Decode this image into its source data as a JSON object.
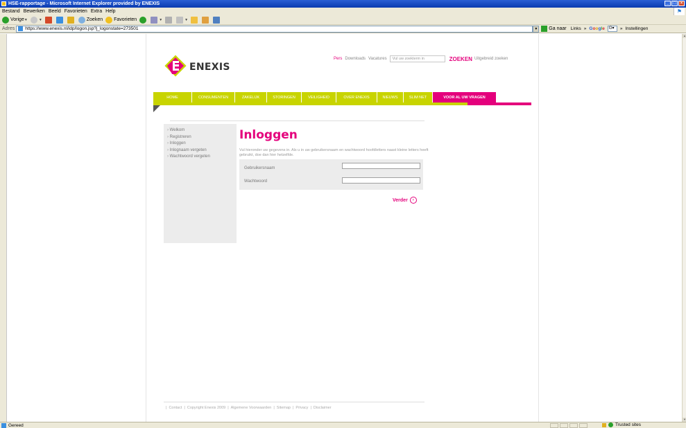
{
  "window": {
    "title": "HSE-rapportage - Microsoft Internet Explorer provided by ENEXIS"
  },
  "menu": [
    "Bestand",
    "Bewerken",
    "Beeld",
    "Favorieten",
    "Extra",
    "Help"
  ],
  "toolbar": {
    "back": "Vorige",
    "search": "Zoeken",
    "favorites": "Favorieten"
  },
  "address": {
    "label": "Adres",
    "url": "https://www.enexis.nl/idp/logon.jsp?j_logonstate=273501",
    "go": "Ga naar",
    "links": "Links",
    "settings": "Instellingen"
  },
  "site": {
    "brand": "ENEXIS",
    "toplinks": [
      "Pers",
      "Downloads",
      "Vacatures"
    ],
    "search_placeholder": "Vul uw zoekterm in",
    "search_button": "ZOEKEN",
    "advanced_search": "Uitgebreid zoeken",
    "nav": [
      "HOME",
      "CONSUMENTEN",
      "ZAKELIJK",
      "STORINGEN",
      "VEILIGHEID",
      "OVER ENEXIS",
      "NIEUWS",
      "SLIM NET",
      "VOOR AL UW VRAGEN"
    ],
    "sidebar": [
      "Welkom",
      "Registreren",
      "Inloggen",
      "Inlognaam vergeten",
      "Wachtwoord vergeten"
    ],
    "heading": "Inloggen",
    "intro": "Vul hieronder uw gegevens in. Als u in uw gebruikersnaam en wachtwoord hoofdletters naast kleine letters heeft gebruikt, doe dan hier hetzelfde.",
    "form": {
      "username_label": "Gebruikersnaam",
      "password_label": "Wachtwoord"
    },
    "submit": "Verder",
    "footer": [
      "Contact",
      "Copyright Enexis 2009",
      "Algemene Voorwaarden",
      "Sitemap",
      "Privacy",
      "Disclaimer"
    ]
  },
  "status": {
    "text": "Gereed",
    "zone": "Trusted sites"
  },
  "colors": {
    "pink": "#e4007c",
    "green": "#c8d400"
  }
}
